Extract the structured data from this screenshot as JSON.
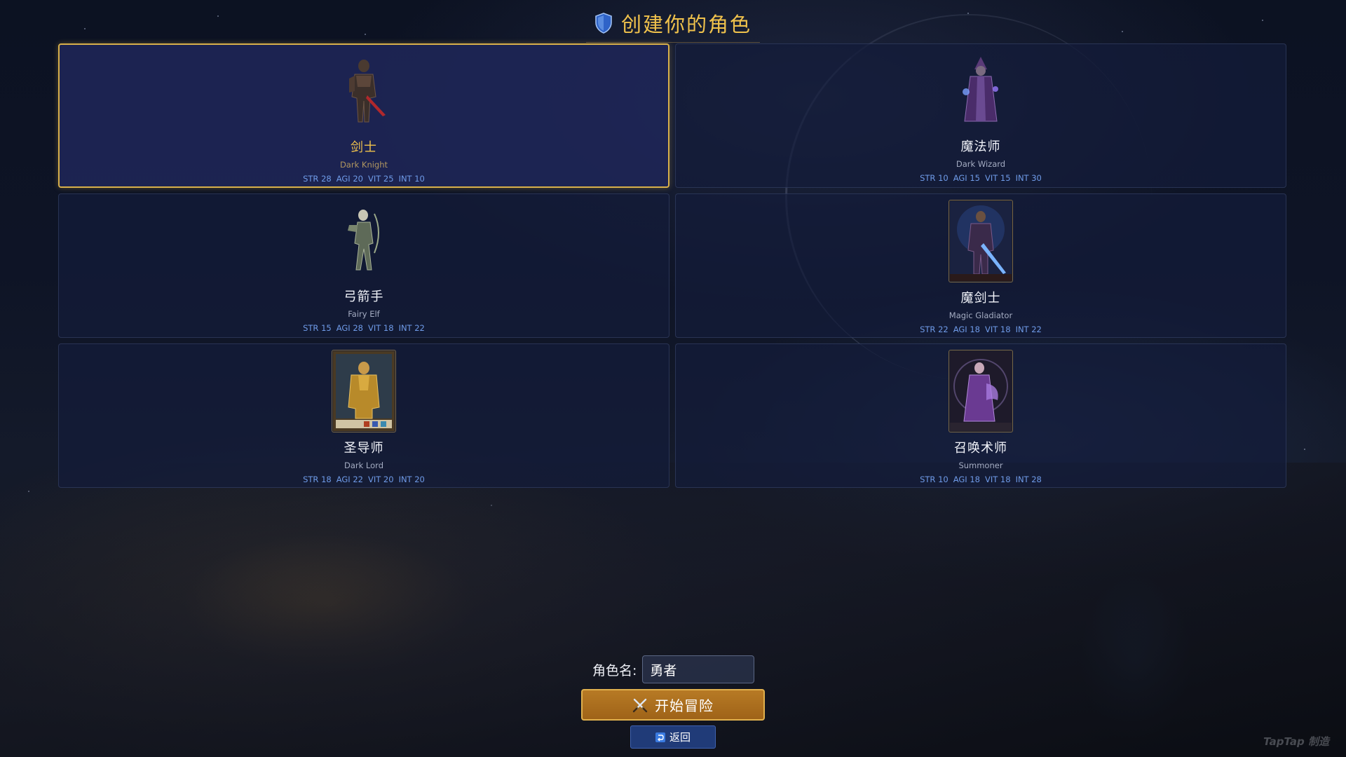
{
  "header": {
    "title": "创建你的角色",
    "icon": "shield-icon"
  },
  "classes": [
    {
      "name_cn": "剑士",
      "name_en": "Dark Knight",
      "selected": true,
      "stats": [
        "STR 28",
        "AGI 20",
        "VIT 25",
        "INT 10"
      ]
    },
    {
      "name_cn": "魔法师",
      "name_en": "Dark Wizard",
      "selected": false,
      "stats": [
        "STR 10",
        "AGI 15",
        "VIT 15",
        "INT 30"
      ]
    },
    {
      "name_cn": "弓箭手",
      "name_en": "Fairy Elf",
      "selected": false,
      "stats": [
        "STR 15",
        "AGI 28",
        "VIT 18",
        "INT 22"
      ]
    },
    {
      "name_cn": "魔剑士",
      "name_en": "Magic Gladiator",
      "selected": false,
      "stats": [
        "STR 22",
        "AGI 18",
        "VIT 18",
        "INT 22"
      ]
    },
    {
      "name_cn": "圣导师",
      "name_en": "Dark Lord",
      "selected": false,
      "stats": [
        "STR 18",
        "AGI 22",
        "VIT 20",
        "INT 20"
      ]
    },
    {
      "name_cn": "召唤术师",
      "name_en": "Summoner",
      "selected": false,
      "stats": [
        "STR 10",
        "AGI 18",
        "VIT 18",
        "INT 28"
      ]
    }
  ],
  "form": {
    "name_label": "角色名:",
    "name_value": "勇者"
  },
  "buttons": {
    "start_label": "开始冒险",
    "start_icon": "crossed-swords-icon",
    "back_label": "返回",
    "back_icon": "return-icon"
  },
  "watermark": "TapTap 制造",
  "colors": {
    "accent_gold": "#f0c24c",
    "stat_blue": "#6f9be8",
    "start_button": "#b77a25",
    "back_button": "#203b78"
  }
}
